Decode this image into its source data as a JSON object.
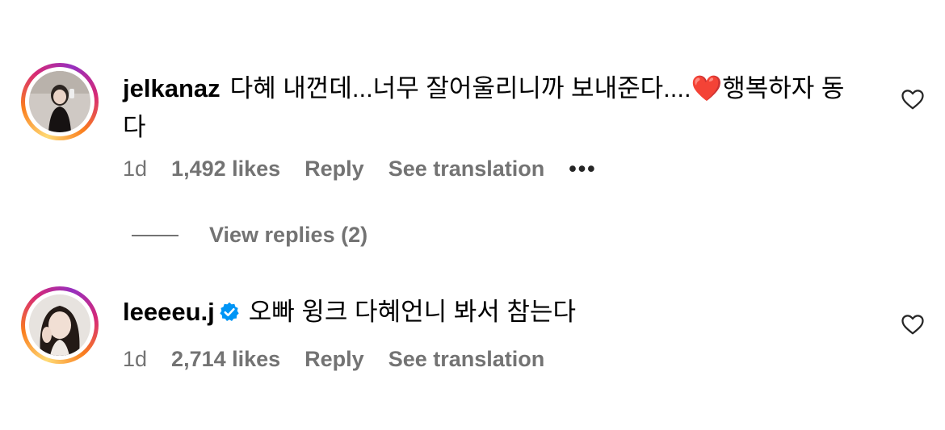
{
  "comments": [
    {
      "username": "jelkanaz",
      "text_before_emoji": "다혜 내껀데...너무 잘어울리니까 보내준다....",
      "emoji": "❤️",
      "text_after_emoji": "행복하자 동다",
      "time": "1d",
      "likes": "1,492 likes",
      "reply": "Reply",
      "translation": "See translation",
      "more": "•••",
      "verified": false
    },
    {
      "username": "leeeeu.j",
      "text": "오빠 윙크 다혜언니 봐서 참는다",
      "time": "1d",
      "likes": "2,714 likes",
      "reply": "Reply",
      "translation": "See translation",
      "verified": true
    }
  ],
  "view_replies": "View replies (2)",
  "colors": {
    "meta_text": "#737373",
    "verified_blue": "#0095f6",
    "heart_red": "#ed2a3c"
  }
}
